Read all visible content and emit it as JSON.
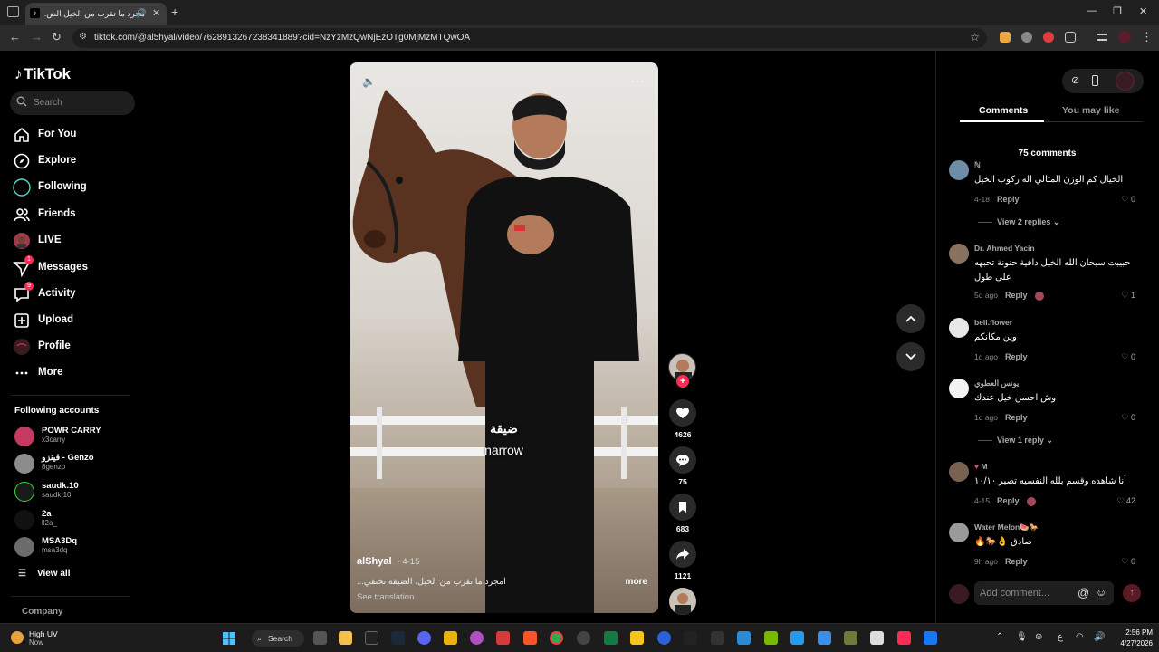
{
  "browser": {
    "tab_title": "مجرد ما تقرب من الخيل الض...",
    "url": "tiktok.com/@al5hyal/video/7628913267238341889?cid=NzYzMzQwNjEzOTg0MjMzMTQwOA"
  },
  "sidebar": {
    "logo": "TikTok",
    "search_placeholder": "Search",
    "nav": [
      {
        "label": "For You",
        "icon": "home-icon"
      },
      {
        "label": "Explore",
        "icon": "compass-icon"
      },
      {
        "label": "Following",
        "icon": "following-icon"
      },
      {
        "label": "Friends",
        "icon": "friends-icon"
      },
      {
        "label": "LIVE",
        "icon": "live-icon"
      },
      {
        "label": "Messages",
        "icon": "messages-icon",
        "badge": "1"
      },
      {
        "label": "Activity",
        "icon": "activity-icon",
        "badge": "9"
      },
      {
        "label": "Upload",
        "icon": "upload-icon"
      },
      {
        "label": "Profile",
        "icon": "profile-icon"
      },
      {
        "label": "More",
        "icon": "more-icon"
      }
    ],
    "following_title": "Following accounts",
    "accounts": [
      {
        "name": "POWR CARRY",
        "handle": "x3carry"
      },
      {
        "name": "قينزو - Genzo",
        "handle": "8genzo"
      },
      {
        "name": "saudk.10",
        "handle": "saudk.10"
      },
      {
        "name": "2a",
        "handle": "ll2a_"
      },
      {
        "name": "MSA3Dq",
        "handle": "msa3dq"
      }
    ],
    "view_all": "View all",
    "company": "Company"
  },
  "video": {
    "caption_ar": "ضيقة",
    "caption_en": "narrow",
    "author": "alShyal",
    "date": "· 4-15",
    "description": "...امجرد ما تقرب من الخيل، الضيقة تختفي",
    "more": "more",
    "see_translation": "See translation"
  },
  "actions": {
    "likes": "4626",
    "comments": "75",
    "saves": "683",
    "shares": "1121"
  },
  "panel": {
    "tab_comments": "Comments",
    "tab_like": "You may like",
    "count": "75 comments",
    "comments": [
      {
        "user": "ℕ",
        "text": "الخيال كم الوزن المثالي اله ركوب الخيل",
        "date": "4-18",
        "reply": "Reply",
        "likes": "0",
        "replies": "View 2 replies"
      },
      {
        "user": "Dr. Ahmed Yacin",
        "text": "حبيبت سبحان الله الخيل دافية حنونة تحبهه على طول",
        "date": "5d ago",
        "reply": "Reply",
        "likes": "1"
      },
      {
        "user": "bell.flower",
        "text": "وين مكانكم",
        "date": "1d ago",
        "reply": "Reply",
        "likes": "0"
      },
      {
        "user": "يونس العطوي",
        "text": "وش احسن خيل عندك",
        "date": "1d ago",
        "reply": "Reply",
        "likes": "0",
        "replies": "View 1 reply"
      },
      {
        "user": "M",
        "text": "أنا شاهده وقسم بلله النفسيه تصير ١٠/١٠",
        "date": "4-15",
        "reply": "Reply",
        "likes": "42"
      },
      {
        "user": "Water Melon🍉🐎",
        "text": "صادق 👌🐎🔥",
        "date": "9h ago",
        "reply": "Reply",
        "likes": "0"
      }
    ],
    "add_comment": "Add comment..."
  },
  "taskbar": {
    "weather_title": "High UV",
    "weather_sub": "Now",
    "search": "Search",
    "time": "2:56 PM",
    "date": "4/27/2026"
  },
  "colors": {
    "accent": "#fe2c55",
    "bg": "#000000",
    "panel": "#1e1e1e"
  }
}
